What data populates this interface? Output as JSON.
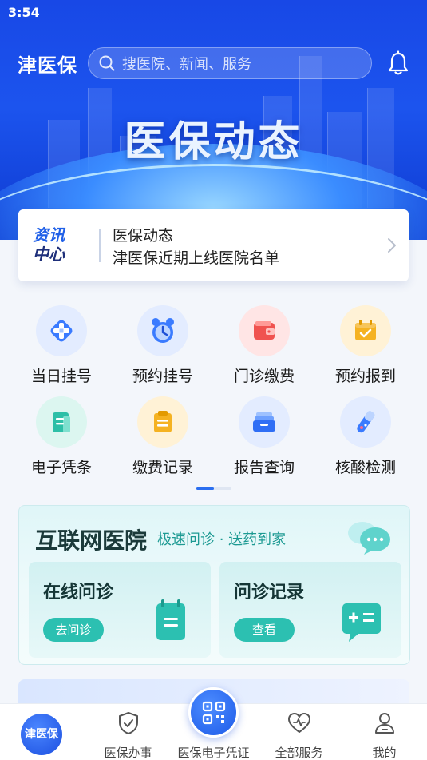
{
  "status_bar": {
    "time": "3:54"
  },
  "header": {
    "brand": "津医保",
    "search_placeholder": "搜医院、新闻、服务",
    "icons": [
      "search-icon",
      "bell-icon"
    ]
  },
  "banner": {
    "title": "医保动态"
  },
  "news": {
    "tag_line1": "资讯",
    "tag_line2": "中心",
    "title": "医保动态",
    "subtitle": "津医保近期上线医院名单"
  },
  "services": [
    {
      "label": "当日挂号",
      "icon": "medical-cross-icon",
      "color": "#2f6ef5"
    },
    {
      "label": "预约挂号",
      "icon": "alarm-clock-icon",
      "color": "#2f6ef5"
    },
    {
      "label": "门诊缴费",
      "icon": "wallet-icon",
      "color": "#f0524f"
    },
    {
      "label": "预约报到",
      "icon": "calendar-check-icon",
      "color": "#f5b221"
    },
    {
      "label": "电子凭条",
      "icon": "receipt-icon",
      "color": "#2dbfa7"
    },
    {
      "label": "缴费记录",
      "icon": "clipboard-icon",
      "color": "#f5b221"
    },
    {
      "label": "报告查询",
      "icon": "inbox-tray-icon",
      "color": "#2f6ef5"
    },
    {
      "label": "核酸检测",
      "icon": "test-tube-icon",
      "color": "#2f6ef5"
    }
  ],
  "internet_hospital": {
    "title": "互联网医院",
    "subtitle": "极速问诊 · 送药到家",
    "cards": [
      {
        "title": "在线问诊",
        "button": "去问诊",
        "icon": "notepad-icon"
      },
      {
        "title": "问诊记录",
        "button": "查看",
        "icon": "calculator-board-icon"
      }
    ]
  },
  "tabbar": {
    "home_label": "津医保",
    "items": [
      "医保办事",
      "医保电子凭证",
      "全部服务",
      "我的"
    ]
  }
}
